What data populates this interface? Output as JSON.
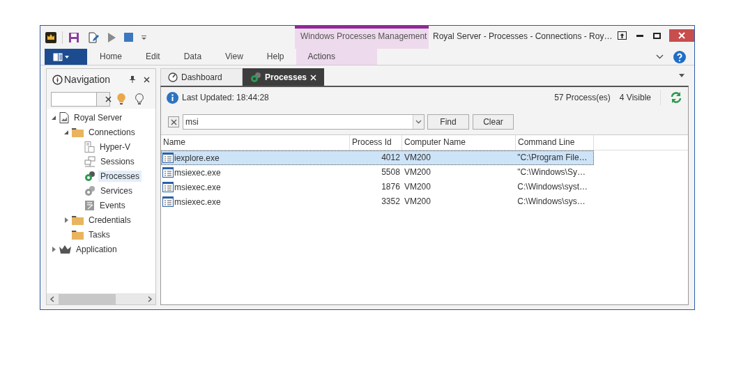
{
  "window": {
    "title": "Royal Server - Processes - Connections - Roy…",
    "context_tab_group": "Windows Processes Management"
  },
  "ribbon_tabs": [
    {
      "label": "Home",
      "selected": false
    },
    {
      "label": "Edit",
      "selected": false
    },
    {
      "label": "Data",
      "selected": false
    },
    {
      "label": "View",
      "selected": false
    },
    {
      "label": "Help",
      "selected": false
    },
    {
      "label": "Actions",
      "selected": false
    }
  ],
  "navigation": {
    "title": "Navigation",
    "tree": [
      {
        "label": "Royal Server",
        "kind": "server",
        "selected": false,
        "expanded": true,
        "children": [
          {
            "label": "Connections",
            "kind": "folder",
            "selected": false,
            "expanded": true,
            "children": [
              {
                "label": "Hyper-V",
                "kind": "hyperv",
                "selected": false
              },
              {
                "label": "Sessions",
                "kind": "sessions",
                "selected": false
              },
              {
                "label": "Processes",
                "kind": "processes",
                "selected": true
              },
              {
                "label": "Services",
                "kind": "services",
                "selected": false
              },
              {
                "label": "Events",
                "kind": "events",
                "selected": false
              }
            ]
          },
          {
            "label": "Credentials",
            "kind": "folder",
            "selected": false,
            "expanded": false
          },
          {
            "label": "Tasks",
            "kind": "folder",
            "selected": false
          }
        ]
      },
      {
        "label": "Application",
        "kind": "app",
        "selected": false,
        "expanded": false
      }
    ]
  },
  "doc_tabs": [
    {
      "label": "Dashboard",
      "kind": "dashboard",
      "selected": false
    },
    {
      "label": "Processes",
      "kind": "processes",
      "selected": true,
      "closable": true
    }
  ],
  "info": {
    "last_updated": "Last Updated: 18:44:28",
    "process_count": "57 Process(es)",
    "visible_count": "4 Visible"
  },
  "filter": {
    "value": "msi",
    "find": "Find",
    "clear": "Clear"
  },
  "table": {
    "columns": [
      "Name",
      "Process Id",
      "Computer Name",
      "Command Line"
    ],
    "rows": [
      {
        "name": "iexplore.exe",
        "pid": "4012",
        "computer": "VM200",
        "command": "\"C:\\Program File…",
        "selected": true
      },
      {
        "name": "msiexec.exe",
        "pid": "5508",
        "computer": "VM200",
        "command": "\"C:\\Windows\\Sy…",
        "selected": false
      },
      {
        "name": "msiexec.exe",
        "pid": "1876",
        "computer": "VM200",
        "command": "C:\\Windows\\syst…",
        "selected": false
      },
      {
        "name": "msiexec.exe",
        "pid": "3352",
        "computer": "VM200",
        "command": "C:\\Windows\\sys…",
        "selected": false
      }
    ]
  }
}
